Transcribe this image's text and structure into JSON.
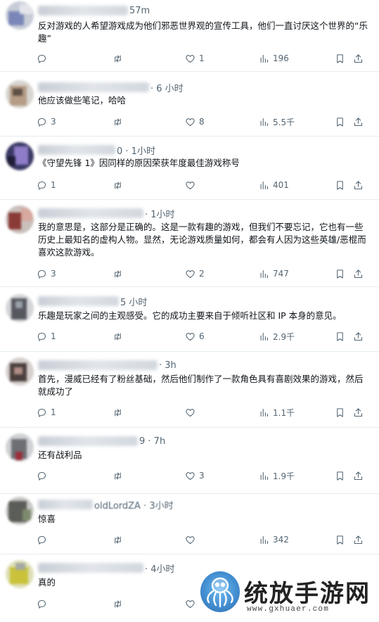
{
  "tweets": [
    {
      "time": "57m",
      "text": "反对游戏的人希望游戏成为他们邪恶世界观的宣传工具，他们一直讨厌这个世界的“乐趣”",
      "stats": {
        "replies": "",
        "retweets": "",
        "likes": "1",
        "views": "196"
      }
    },
    {
      "time": "· 6 小时",
      "text": "他应该做些笔记，哈哈",
      "stats": {
        "replies": "3",
        "retweets": "",
        "likes": "8",
        "views": "5.5千"
      }
    },
    {
      "time": "0 · 1小时",
      "text": "《守望先锋 1》因同样的原因荣获年度最佳游戏称号",
      "stats": {
        "replies": "1",
        "retweets": "",
        "likes": "",
        "views": "401"
      }
    },
    {
      "time": "· 1小时",
      "text": "我的意思是，这部分是正确的。这是一款有趣的游戏，但我们不要忘记，它也有一些历史上最知名的虚构人物。显然，无论游戏质量如何，都会有人因为这些英雄/恶棍而喜欢这款游戏。",
      "stats": {
        "replies": "3",
        "retweets": "",
        "likes": "2",
        "views": "747"
      }
    },
    {
      "time": "5 小时",
      "text": "乐趣是玩家之间的主观感受。它的成功主要来自于倾听社区和 IP 本身的意见。",
      "stats": {
        "replies": "1",
        "retweets": "",
        "likes": "6",
        "views": "2.9千"
      }
    },
    {
      "time": "· 3h",
      "text": "首先，漫威已经有了粉丝基础，然后他们制作了一款角色具有喜剧效果的游戏，然后就成功了",
      "stats": {
        "replies": "1",
        "retweets": "",
        "likes": "",
        "views": "1.1千"
      }
    },
    {
      "time": "9 · 7h",
      "text": "还有战利品",
      "stats": {
        "replies": "",
        "retweets": "",
        "likes": "3",
        "views": "1.9千"
      }
    },
    {
      "time": "oldLordZA · 3小时",
      "text": "惊喜",
      "stats": {
        "replies": "",
        "retweets": "",
        "likes": "",
        "views": "342"
      }
    },
    {
      "time": "· 4小时",
      "text": "真的",
      "stats": {
        "replies": "",
        "retweets": "",
        "likes": "",
        "views": ""
      }
    }
  ],
  "watermark": {
    "text": "统放手游网",
    "url": "www.gxhuaer.com"
  },
  "colors": {
    "text": "#0f1419",
    "muted": "#536471",
    "divider": "#e6ecf0"
  }
}
